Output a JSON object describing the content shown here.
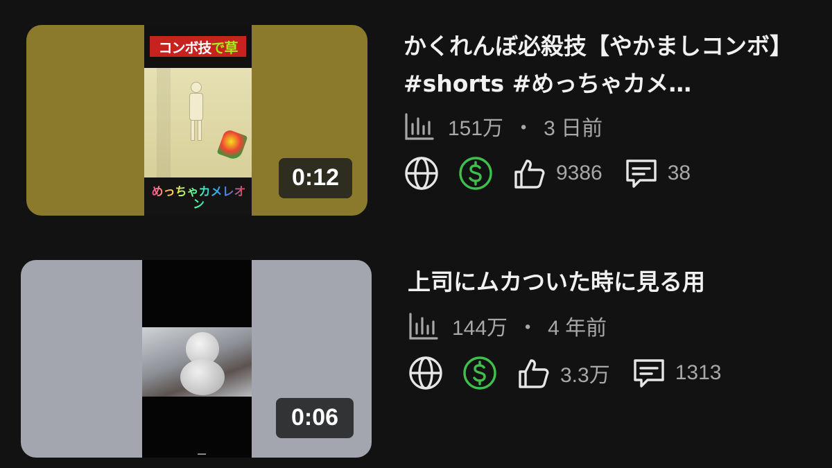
{
  "colors": {
    "background": "#121212",
    "text_primary": "#f1f1f1",
    "text_secondary": "#a8a8a8",
    "monetization_green": "#3fbf4b"
  },
  "videos": [
    {
      "thumbnail": {
        "banner_text_red": "コンボ技",
        "banner_text_green": "で草",
        "channel_logo_text": "めっちゃカメレオン",
        "duration": "0:12"
      },
      "title": "かくれんぼ必殺技【やかましコンボ】 #shorts #めっちゃカメ…",
      "views": "151万",
      "separator": "・",
      "age": "3 日前",
      "icons": [
        "stats-icon",
        "globe-icon",
        "dollar-icon",
        "thumbs-up-icon",
        "comment-icon"
      ],
      "likes": "9386",
      "comments": "38"
    },
    {
      "thumbnail": {
        "duration": "0:06"
      },
      "title": "上司にムカついた時に見る用",
      "views": "144万",
      "separator": "・",
      "age": "4 年前",
      "icons": [
        "stats-icon",
        "globe-icon",
        "dollar-icon",
        "thumbs-up-icon",
        "comment-icon"
      ],
      "likes": "3.3万",
      "comments": "1313"
    }
  ]
}
